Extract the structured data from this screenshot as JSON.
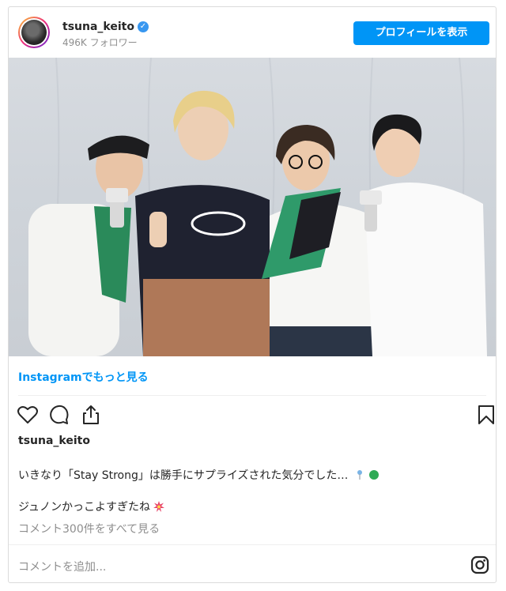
{
  "header": {
    "username": "tsuna_keito",
    "verified_icon": "verified-badge-icon",
    "followers": "496K フォロワー",
    "view_profile_label": "プロフィールを表示"
  },
  "post": {
    "more_link": "Instagramでもっと見る",
    "owner": "tsuna_keito",
    "caption_line1": "いきなり「Stay Strong」は勝手にサプライズされた気分でした…",
    "caption_line2": "ジュノンかっこよすぎたね",
    "view_comments": "コメント300件をすべて見る",
    "add_comment_placeholder": "コメントを追加..."
  },
  "icons": {
    "like": "heart-icon",
    "comment": "comment-icon",
    "share": "share-icon",
    "save": "bookmark-icon",
    "instagram": "instagram-icon"
  },
  "colors": {
    "accent": "#0095f6",
    "text": "#262626",
    "muted": "#8e8e8e"
  }
}
